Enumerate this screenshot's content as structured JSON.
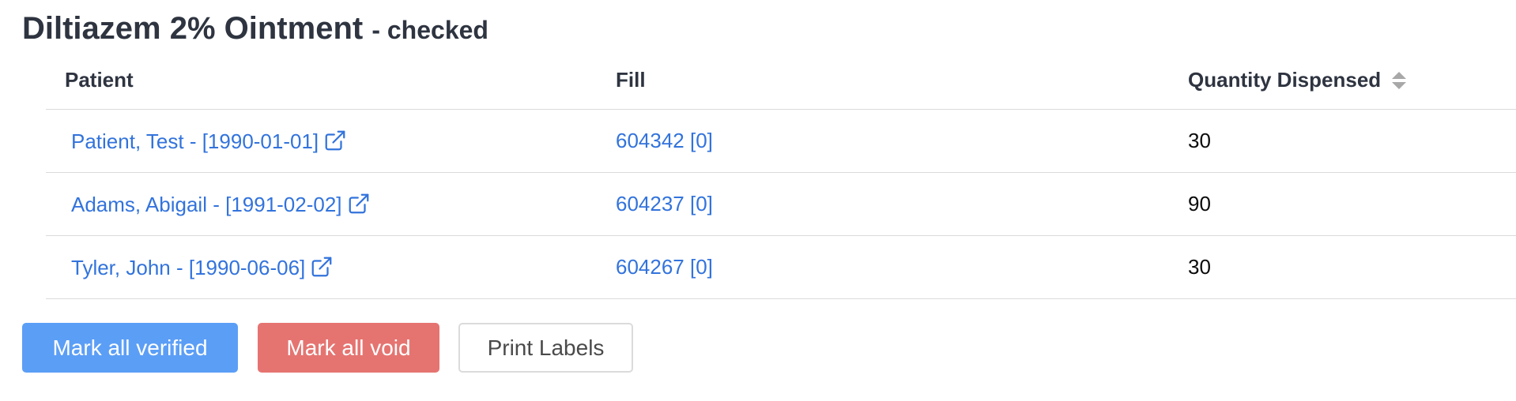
{
  "header": {
    "title": "Diltiazem 2% Ointment",
    "status": "- checked"
  },
  "table": {
    "columns": {
      "patient": "Patient",
      "fill": "Fill",
      "quantity": "Quantity Dispensed"
    },
    "rows": [
      {
        "patient": "Patient, Test -  [1990-01-01]",
        "fill": "604342 [0]",
        "quantity": "30"
      },
      {
        "patient": "Adams, Abigail -  [1991-02-02]",
        "fill": "604237 [0]",
        "quantity": "90"
      },
      {
        "patient": "Tyler, John -  [1990-06-06]",
        "fill": "604267 [0]",
        "quantity": "30"
      }
    ]
  },
  "actions": {
    "verify_label": "Mark all verified",
    "void_label": "Mark all void",
    "print_label": "Print Labels"
  },
  "colors": {
    "link": "#3273dc",
    "verify": "#5b9ef6",
    "void": "#e57471",
    "heading": "#2e3440"
  },
  "icons": {
    "external_link": "external-link-icon",
    "sort": "sort-icon"
  }
}
